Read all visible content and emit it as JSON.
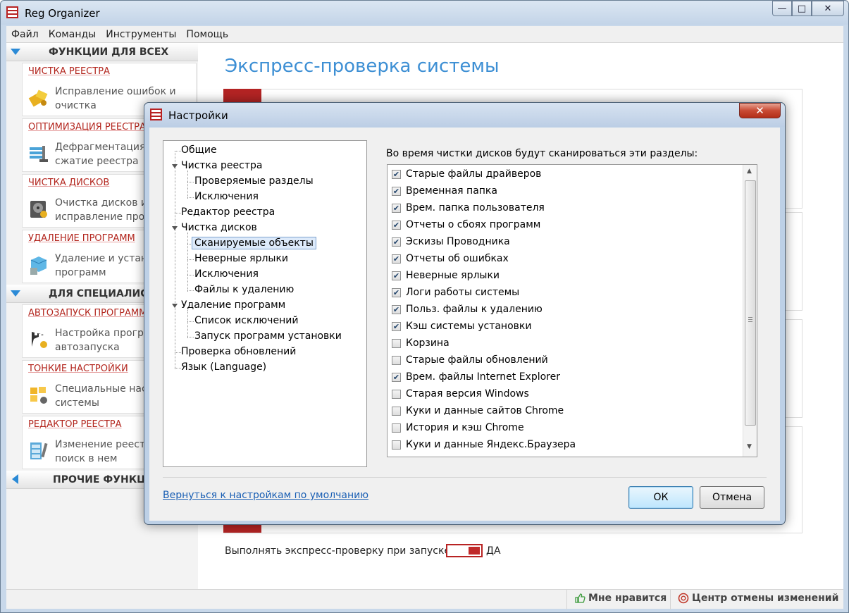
{
  "app": {
    "title": "Reg Organizer"
  },
  "window_controls": {
    "minimize": "—",
    "maximize": "□",
    "close": "✕"
  },
  "menu": [
    "Файл",
    "Команды",
    "Инструменты",
    "Помощь"
  ],
  "sidebar": {
    "groups": [
      {
        "label": "ФУНКЦИИ ДЛЯ ВСЕХ"
      },
      {
        "label": "ДЛЯ СПЕЦИАЛИСТОВ"
      },
      {
        "label": "ПРОЧИЕ ФУНКЦИИ"
      }
    ],
    "cards": [
      {
        "title": "ЧИСТКА РЕЕСТРА",
        "desc": "Исправление ошибок и очистка",
        "icon": "registry-clean-icon"
      },
      {
        "title": "ОПТИМИЗАЦИЯ РЕЕСТРА",
        "desc": "Дефрагментация и сжатие реестра",
        "icon": "registry-optimize-icon"
      },
      {
        "title": "ЧИСТКА ДИСКОВ",
        "desc": "Очистка дисков и исправление проблем",
        "icon": "disk-clean-icon"
      },
      {
        "title": "УДАЛЕНИЕ ПРОГРАММ",
        "desc": "Удаление и установка программ",
        "icon": "uninstall-icon"
      },
      {
        "title": "АВТОЗАПУСК ПРОГРАММ",
        "desc": "Настройка программ автозапуска",
        "icon": "autorun-icon"
      },
      {
        "title": "ТОНКИЕ НАСТРОЙКИ",
        "desc": "Специальные настройки системы",
        "icon": "tweaks-icon"
      },
      {
        "title": "РЕДАКТОР РЕЕСТРА",
        "desc": "Изменение реестра и поиск в нем",
        "icon": "registry-editor-icon"
      }
    ]
  },
  "main": {
    "title": "Экспресс-проверка системы",
    "express_label": "Выполнять экспресс-проверку при запуске:",
    "toggle_label": "ДА"
  },
  "statusbar": {
    "like": "Мне нравится",
    "undo_center": "Центр отмены изменений"
  },
  "dialog": {
    "title": "Настройки",
    "close": "✕",
    "tree": [
      {
        "label": "Общие"
      },
      {
        "label": "Чистка реестра"
      },
      {
        "label": "Проверяемые разделы"
      },
      {
        "label": "Исключения"
      },
      {
        "label": "Редактор реестра"
      },
      {
        "label": "Чистка дисков"
      },
      {
        "label": "Сканируемые объекты"
      },
      {
        "label": "Неверные ярлыки"
      },
      {
        "label": "Исключения"
      },
      {
        "label": "Файлы к удалению"
      },
      {
        "label": "Удаление программ"
      },
      {
        "label": "Список исключений"
      },
      {
        "label": "Запуск программ установки"
      },
      {
        "label": "Проверка обновлений"
      },
      {
        "label": "Язык (Language)"
      }
    ],
    "list_caption": "Во время чистки дисков будут сканироваться эти разделы:",
    "items": [
      {
        "label": "Старые файлы драйверов",
        "checked": true
      },
      {
        "label": "Временная папка",
        "checked": true
      },
      {
        "label": "Врем. папка пользователя",
        "checked": true
      },
      {
        "label": "Отчеты о сбоях программ",
        "checked": true
      },
      {
        "label": "Эскизы Проводника",
        "checked": true
      },
      {
        "label": "Отчеты об ошибках",
        "checked": true
      },
      {
        "label": "Неверные ярлыки",
        "checked": true
      },
      {
        "label": "Логи работы системы",
        "checked": true
      },
      {
        "label": "Польз. файлы к удалению",
        "checked": true
      },
      {
        "label": "Кэш системы установки",
        "checked": true
      },
      {
        "label": "Корзина",
        "checked": false
      },
      {
        "label": "Старые файлы обновлений",
        "checked": false
      },
      {
        "label": "Врем. файлы Internet Explorer",
        "checked": true
      },
      {
        "label": "Старая версия Windows",
        "checked": false
      },
      {
        "label": "Куки и данные сайтов Chrome",
        "checked": false
      },
      {
        "label": "История и кэш Chrome",
        "checked": false
      },
      {
        "label": "Куки и данные Яндекс.Браузера",
        "checked": false
      }
    ],
    "reset_link": "Вернуться к настройкам по умолчанию",
    "ok": "ОК",
    "cancel": "Отмена"
  }
}
